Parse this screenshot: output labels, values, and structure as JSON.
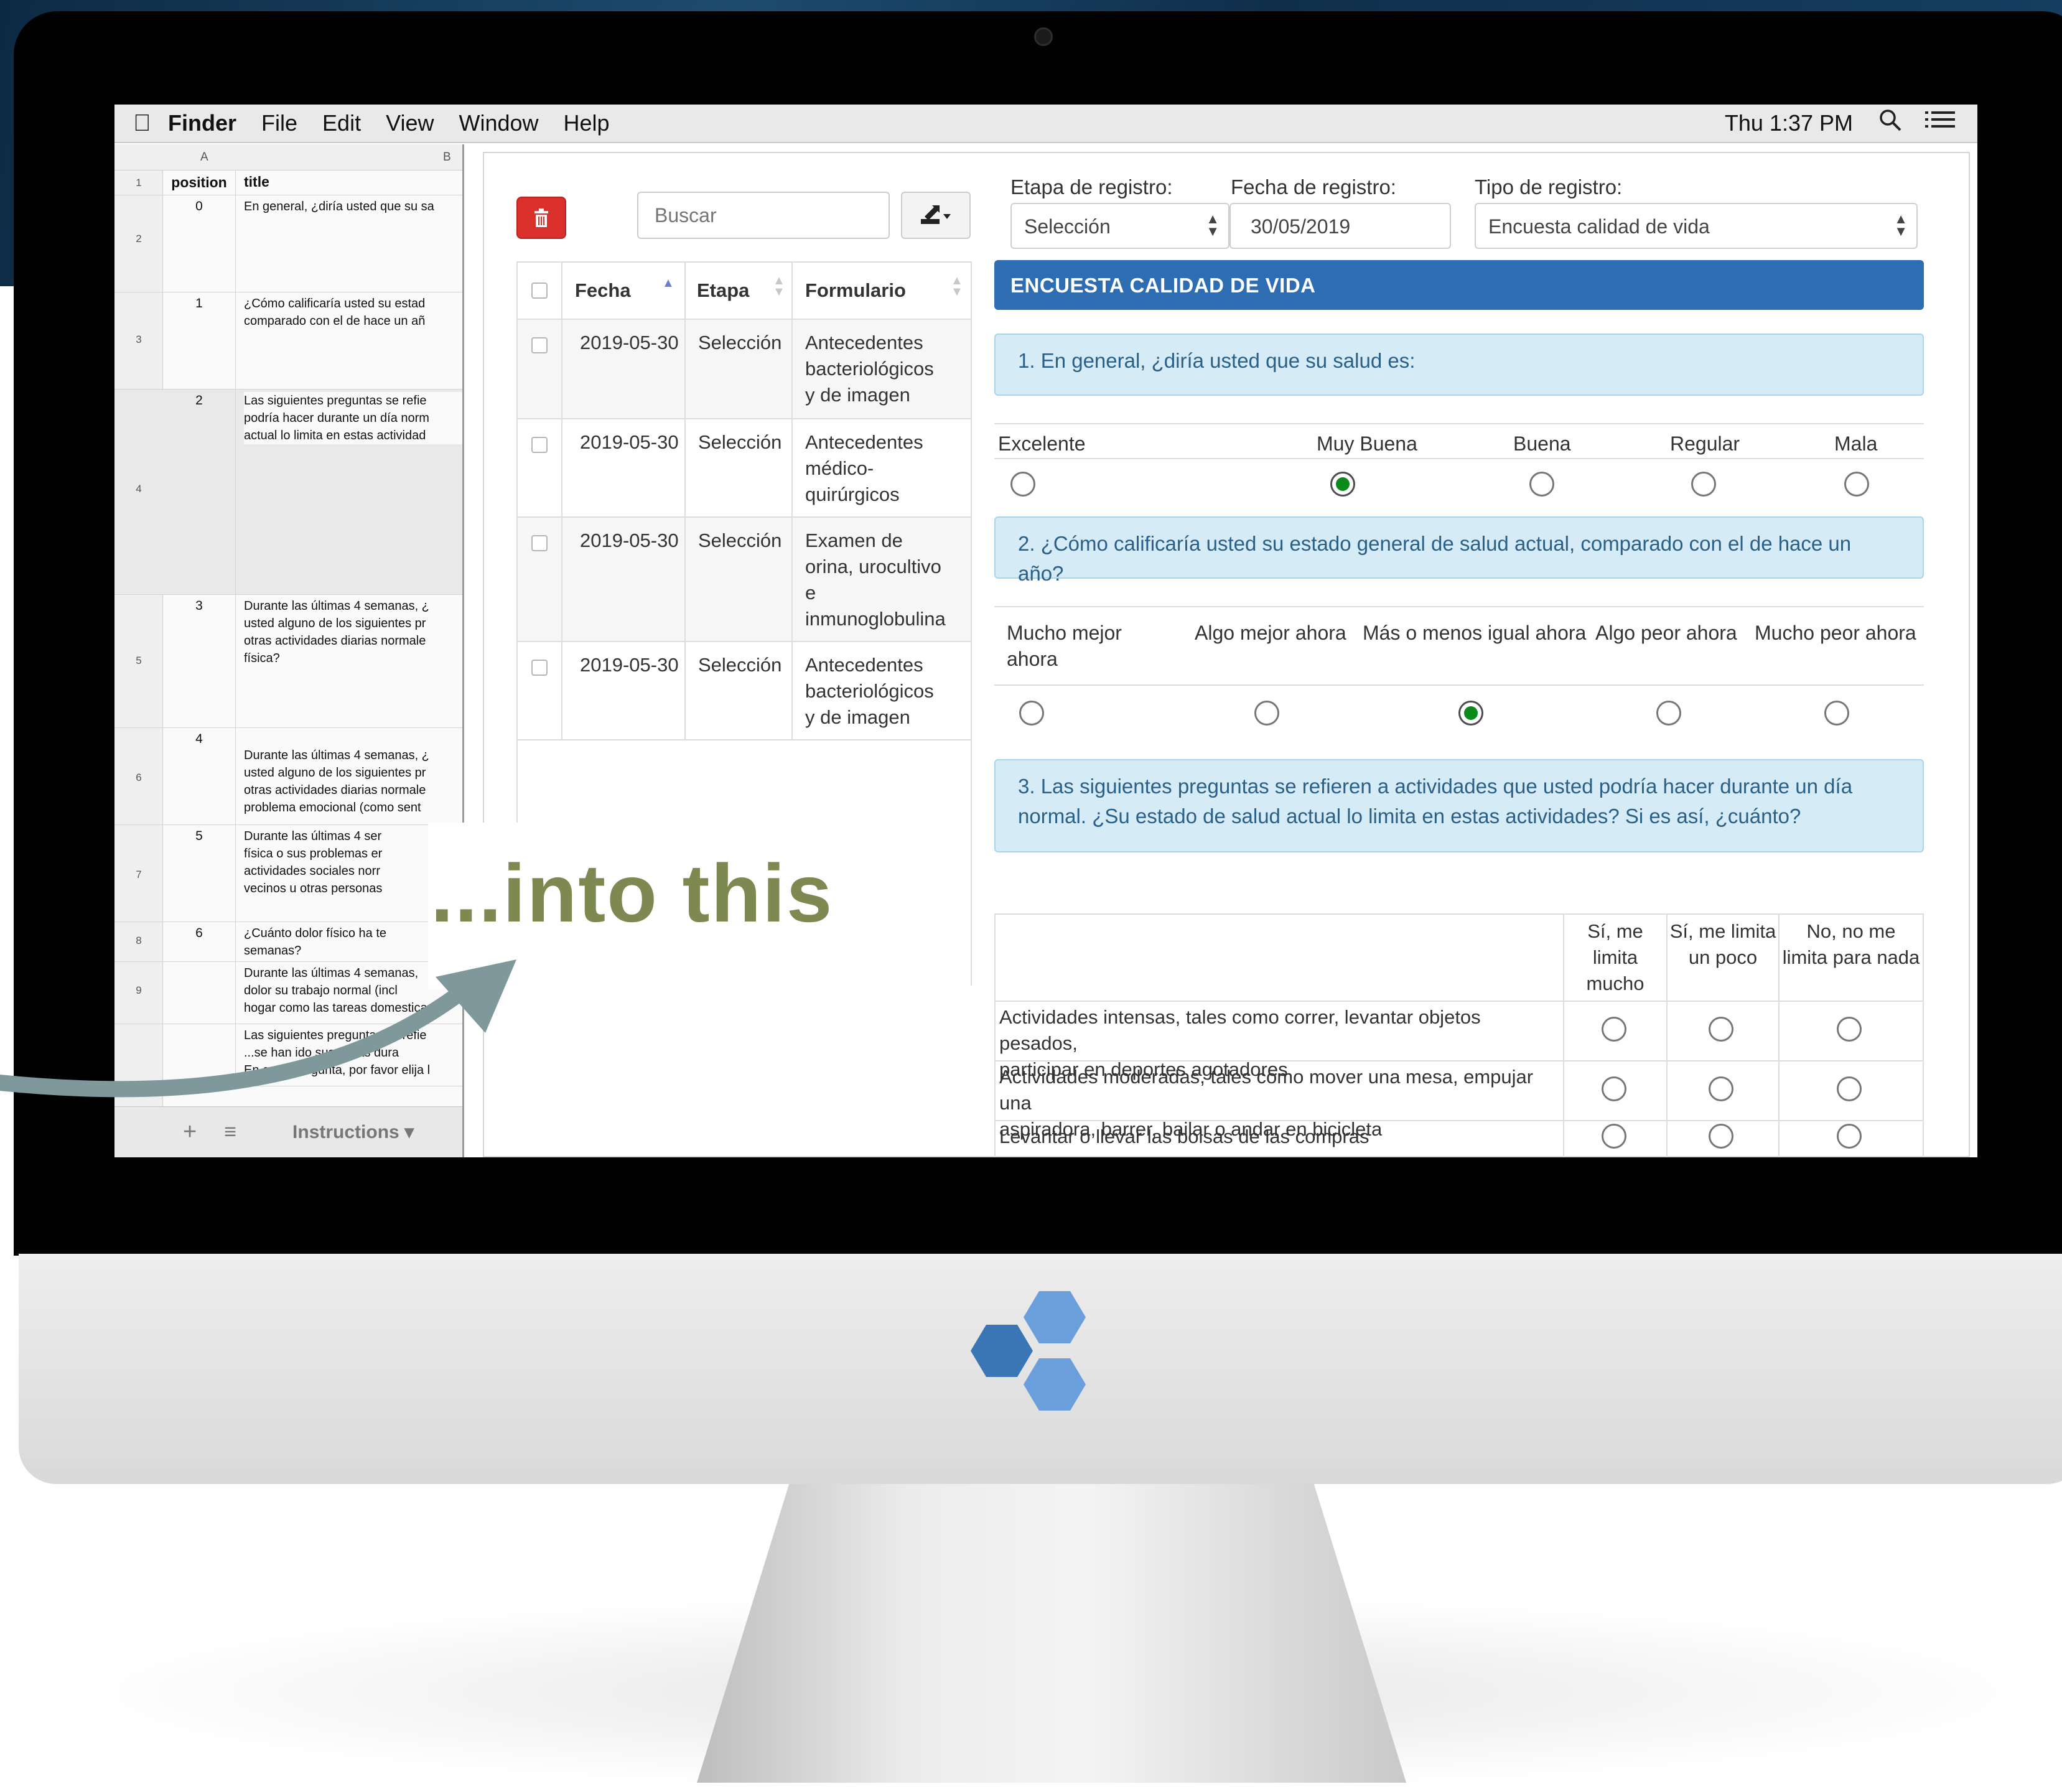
{
  "menubar": {
    "app_name": "Finder",
    "menus": [
      "File",
      "Edit",
      "View",
      "Window",
      "Help"
    ],
    "clock": "Thu 1:37 PM",
    "icons": [
      "apple-icon",
      "search-icon",
      "list-icon"
    ]
  },
  "sheet": {
    "col_a": "A",
    "col_b": "B",
    "rows": [
      {
        "n": "1",
        "position": "position",
        "title": "title"
      },
      {
        "n": "2",
        "position": "0",
        "title": "En general, ¿diría usted que su sa"
      },
      {
        "n": "3",
        "position": "1",
        "title": "¿Cómo calificaría usted su estad\ncomparado con el de hace un añ"
      },
      {
        "n": "4",
        "position": "2",
        "title": "Las siguientes preguntas se refie\npodría hacer durante un día norm\nactual lo limita en estas actividad"
      },
      {
        "n": "5",
        "position": "3",
        "title": "Durante las últimas 4 semanas, ¿\nusted alguno de los siguientes pr\notras actividades diarias normale\nfísica?"
      },
      {
        "n": "6",
        "position": "4",
        "title": "Durante las últimas 4 semanas, ¿\nusted alguno de los siguientes pr\notras actividades diarias normale\nproblema emocional (como sent"
      },
      {
        "n": "7",
        "position": "5",
        "title": "Durante las últimas 4 ser\nfísica o sus problemas er\nactividades sociales norr\nvecinos u otras personas"
      },
      {
        "n": "8",
        "position": "6",
        "title": "¿Cuánto dolor físico ha te\nsemanas?"
      },
      {
        "n": "9",
        "position": "",
        "title": "Durante las últimas 4 semanas,\ndolor su trabajo normal (incl\nhogar como las tareas domestica"
      },
      {
        "n": "",
        "position": "",
        "title": "Las siguientes preguntas se refie\n...se han ido sus cosas dura\nEn cada pregunta, por favor elija l"
      }
    ],
    "tab_label": "Instructions"
  },
  "app": {
    "search_placeholder": "Buscar",
    "grid": {
      "headers": [
        "Fecha",
        "Etapa",
        "Formulario"
      ],
      "rows": [
        {
          "fecha": "2019-05-30",
          "etapa": "Selección",
          "formulario": "Antecedentes\nbacteriológicos\ny de imagen"
        },
        {
          "fecha": "2019-05-30",
          "etapa": "Selección",
          "formulario": "Antecedentes\nmédico-\nquirúrgicos"
        },
        {
          "fecha": "2019-05-30",
          "etapa": "Selección",
          "formulario": "Examen de\norina, urocultivo\ne\ninmunoglobulina"
        },
        {
          "fecha": "2019-05-30",
          "etapa": "Selección",
          "formulario": "Antecedentes\nbacteriológicos\ny de imagen"
        }
      ]
    },
    "filters": {
      "etapa_label": "Etapa de registro:",
      "etapa_value": "Selección",
      "fecha_label": "Fecha de registro:",
      "fecha_value": "30/05/2019",
      "tipo_label": "Tipo de registro:",
      "tipo_value": "Encuesta calidad de vida"
    },
    "section_title": "ENCUESTA CALIDAD DE VIDA",
    "q1": {
      "text": "1. En general, ¿diría usted que su salud es:",
      "options": [
        "Excelente",
        "Muy Buena",
        "Buena",
        "Regular",
        "Mala"
      ],
      "selected_index": 1
    },
    "q2": {
      "text": "2. ¿Cómo calificaría usted su estado general de salud actual, comparado con el de hace un año?",
      "options": [
        "Mucho mejor\nahora",
        "Algo mejor ahora",
        "Más o menos igual ahora",
        "Algo peor ahora",
        "Mucho peor ahora"
      ],
      "selected_index": 2
    },
    "q3": {
      "text": "3. Las siguientes preguntas se refieren a actividades que usted podría hacer durante un día normal. ¿Su estado de salud actual lo limita en estas actividades? Si es así, ¿cuánto?",
      "columns": [
        "Sí, me\nlimita\nmucho",
        "Sí, me limita\nun poco",
        "No, no me\nlimita para nada"
      ],
      "rows": [
        "Actividades intensas, tales como correr, levantar objetos pesados,\nparticipar en deportes agotadores",
        "Actividades moderadas, tales como mover una mesa, empujar una\naspiradora, barrer, bailar o andar en bicicleta",
        "Levantar o llevar las bolsas de las compras"
      ]
    }
  },
  "overlay": {
    "text": "...into this"
  },
  "colors": {
    "accent_blue": "#2e6db1",
    "question_bg": "#d5ebf6",
    "delete_red": "#d9302c",
    "radio_selected": "#0d8a1c",
    "overlay_text": "#7d8951",
    "logo_blue_dark": "#3a76b5",
    "logo_blue_light": "#6b9fdb"
  }
}
